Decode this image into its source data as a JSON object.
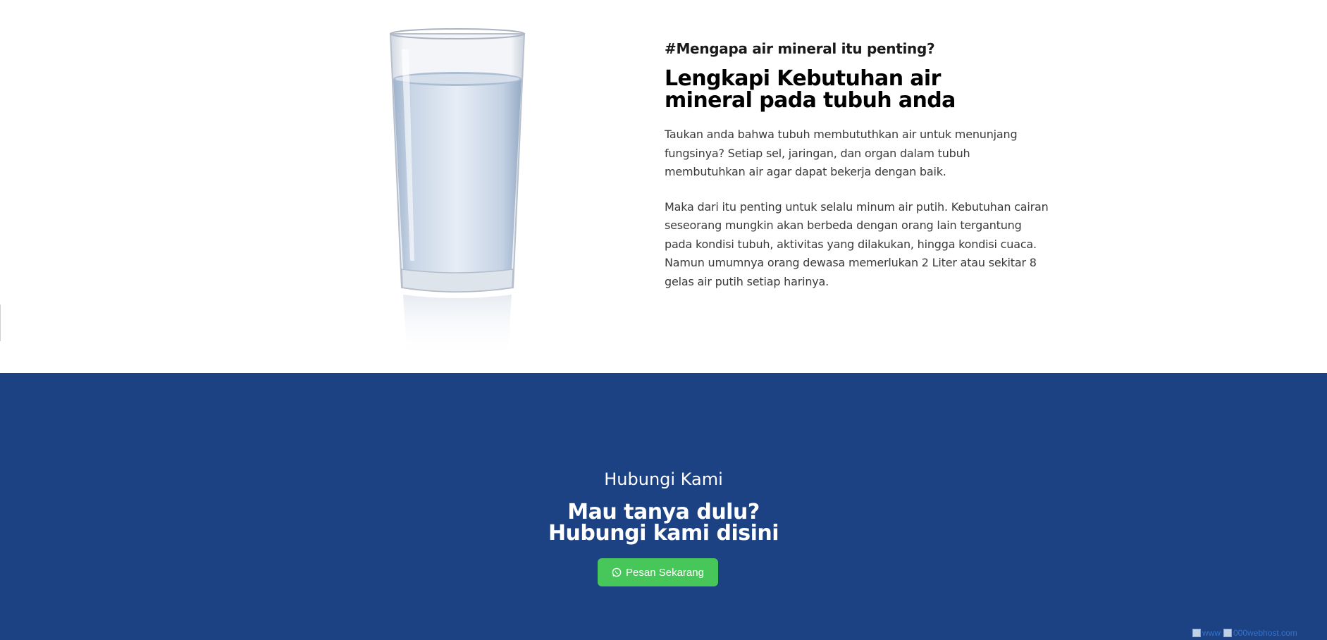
{
  "about": {
    "eyebrow": "#Mengapa air mineral itu penting?",
    "headline": "Lengkapi Kebutuhan air mineral pada tubuh anda",
    "paragraph_1": "Taukan anda bahwa tubuh membututhkan air untuk menunjang fungsinya? Setiap sel, jaringan, dan organ dalam tubuh membutuhkan air agar dapat bekerja dengan baik.",
    "paragraph_2": "Maka dari itu penting untuk selalu minum air putih. Kebutuhan cairan seseorang mungkin akan berbeda dengan orang lain tergantung pada kondisi tubuh, aktivitas yang dilakukan, hingga kondisi cuaca. Namun umumnya orang dewasa memerlukan 2 Liter atau sekitar 8 gelas air putih setiap harinya.",
    "image_icon": "glass-of-water-icon"
  },
  "contact": {
    "subtitle": "Hubungi Kami",
    "title_line_1": "Mau tanya dulu?",
    "title_line_2": "Hubungi kami disini",
    "button_label": "Pesan Sekarang",
    "button_icon": "whatsapp-icon"
  },
  "footer_badge": {
    "alt_text_1": "www",
    "alt_text_2": "000webhost.com"
  },
  "colors": {
    "contact_background": "#1c4283",
    "button_background": "#47c75a",
    "text_dark": "#1a1a1a",
    "text_body": "#3a3a3a"
  }
}
